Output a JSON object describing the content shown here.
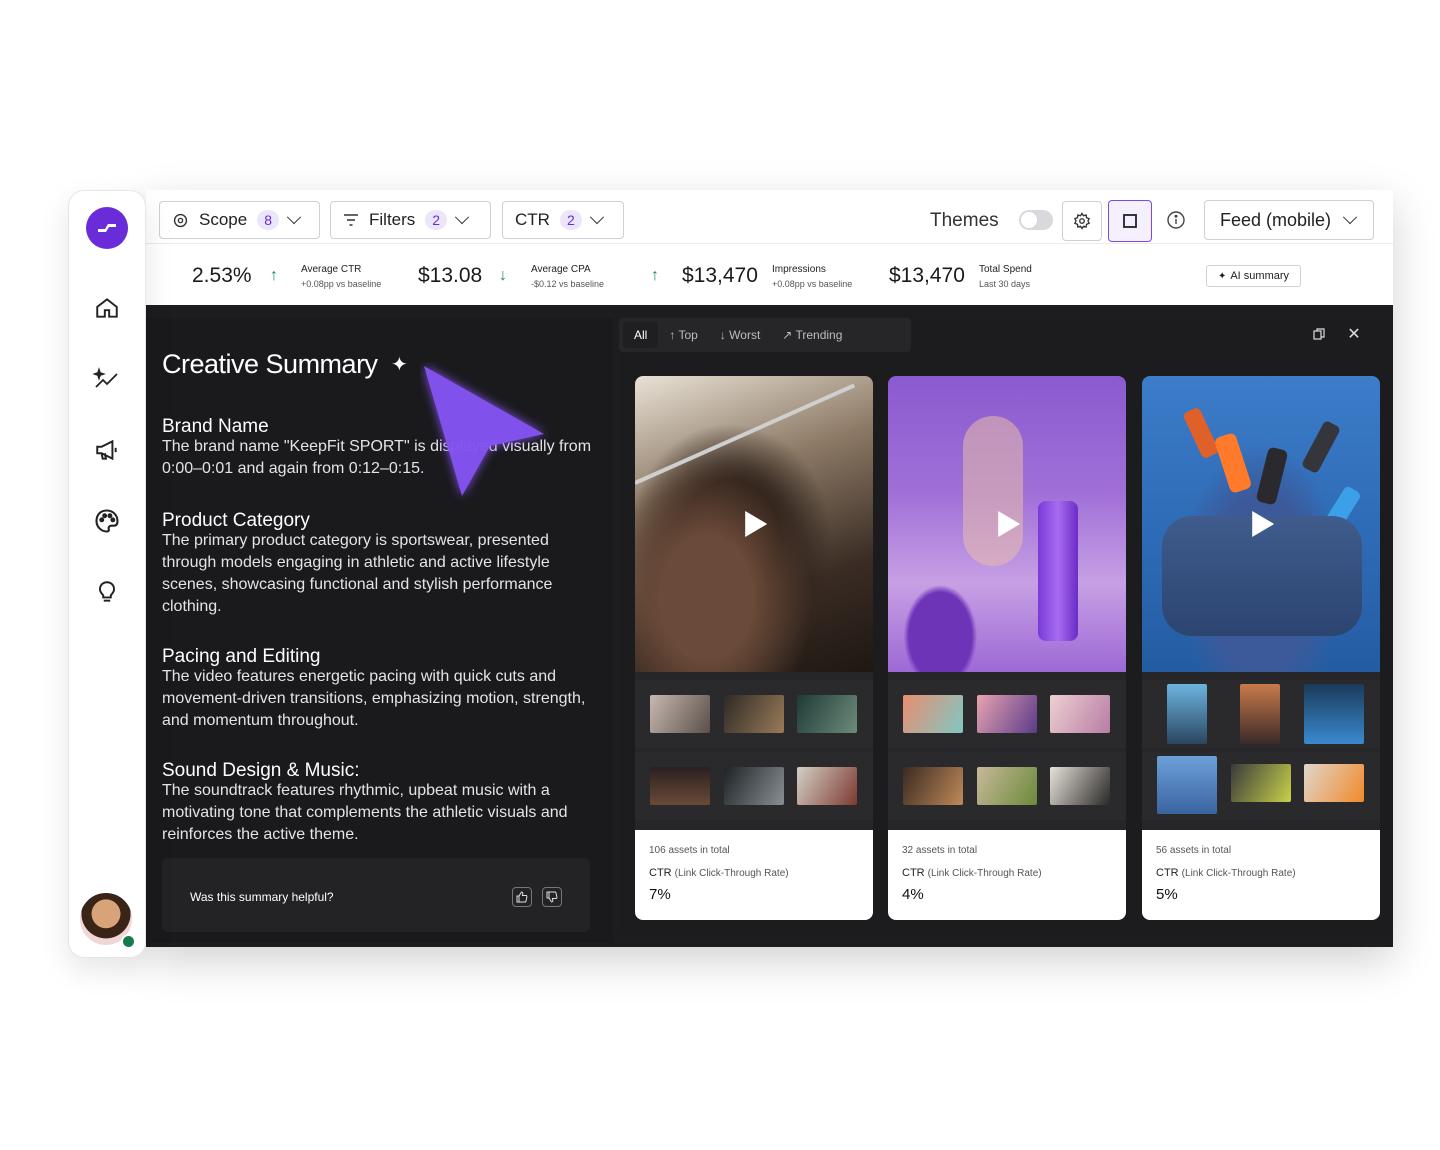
{
  "toolbar": {
    "scope": {
      "label": "Scope",
      "count": "8"
    },
    "filters": {
      "label": "Filters",
      "count": "2"
    },
    "ctr": {
      "label": "CTR",
      "count": "2"
    },
    "themes_label": "Themes",
    "feed_select": "Feed (mobile)"
  },
  "metrics": [
    {
      "value": "2.53%",
      "label": "Average CTR",
      "sub": "+0.08pp vs baseline",
      "trend": "up"
    },
    {
      "value": "$13.08",
      "label": "Average CPA",
      "sub": "-$0.12 vs baseline",
      "trend": "down"
    },
    {
      "value": "$13,470",
      "label": "Impressions",
      "sub": "+0.08pp vs baseline",
      "trend": "up"
    },
    {
      "value": "$13,470",
      "label": "Total Spend",
      "sub": "Last 30 days"
    }
  ],
  "ai_summary_label": "AI summary",
  "summary": {
    "title": "Creative Summary",
    "sections": [
      {
        "heading": "Brand Name",
        "body": "The brand name \"KeepFit SPORT\" is displayed visually from 0:00–0:01 and again from 0:12–0:15."
      },
      {
        "heading": "Product Category",
        "body": "The primary product category is sportswear, presented through models engaging in athletic and active lifestyle scenes, showcasing functional and stylish performance clothing."
      },
      {
        "heading": "Pacing and Editing",
        "body": "The video features energetic pacing with quick cuts and movement-driven transitions, emphasizing motion, strength, and momentum throughout."
      },
      {
        "heading": "Sound Design & Music:",
        "body": "The soundtrack features rhythmic, upbeat music with a motivating tone that complements the athletic visuals and reinforces the active theme."
      }
    ],
    "feedback_question": "Was this summary helpful?"
  },
  "tabs": [
    {
      "label": "All",
      "icon": ""
    },
    {
      "label": "Top",
      "icon": "↑"
    },
    {
      "label": "Worst",
      "icon": "↓"
    },
    {
      "label": "Trending",
      "icon": "↗"
    }
  ],
  "cards": [
    {
      "assets": "106 assets in total",
      "metric": "CTR",
      "metric_full": "(Link Click-Through Rate)",
      "value": "7%"
    },
    {
      "assets": "32 assets in total",
      "metric": "CTR",
      "metric_full": "(Link Click-Through Rate)",
      "value": "4%"
    },
    {
      "assets": "56 assets in total",
      "metric": "CTR",
      "metric_full": "(Link Click-Through Rate)",
      "value": "5%"
    }
  ],
  "colors": {
    "accent": "#6a2bd8",
    "up": "#1a8a5a",
    "down": "#1a8a5a",
    "dark_bg": "#1d1d1f"
  }
}
